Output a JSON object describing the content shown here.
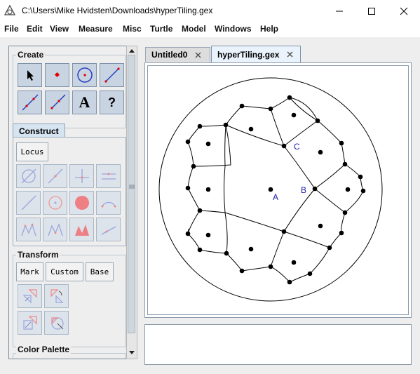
{
  "window": {
    "title": "C:\\Users\\Mike Hvidsten\\Downloads\\hyperTiling.gex"
  },
  "window_controls": [
    "minimize",
    "maximize",
    "close"
  ],
  "menu": [
    "File",
    "Edit",
    "View",
    "Measure",
    "Misc",
    "Turtle",
    "Model",
    "Windows",
    "Help"
  ],
  "panel": {
    "create_title": "Create",
    "create_tools": [
      "pointer-icon",
      "point-icon",
      "circle-icon",
      "segment-icon",
      "line-icon",
      "ray-icon",
      "text-icon",
      "help-icon"
    ],
    "text_tool_glyph": "A",
    "help_tool_glyph": "?",
    "construct_tab": "Construct",
    "locus_label": "Locus",
    "construct_tools": [
      "intersect-icon",
      "midpoint-icon",
      "perpendicular-icon",
      "parallel-icon",
      "bisector-icon",
      "circle-center-icon",
      "filled-circle-icon",
      "arc-icon",
      "polygon-icon",
      "filled-polygon-icon",
      "filled-polygon-shaded-icon",
      "ray-point-icon"
    ],
    "transform_title": "Transform",
    "transform_buttons": [
      "Mark",
      "Custom",
      "Base"
    ],
    "transform_tools": [
      "translate-icon",
      "rotate-icon",
      "dilate-icon",
      "reflect-icon"
    ],
    "palette_title": "Color Palette"
  },
  "tabs": [
    {
      "label": "Untitled0",
      "active": false
    },
    {
      "label": "hyperTiling.gex",
      "active": true
    }
  ],
  "canvas": {
    "labels": {
      "A": "A",
      "B": "B",
      "C": "C"
    },
    "label_color": "#1a1aa8"
  }
}
